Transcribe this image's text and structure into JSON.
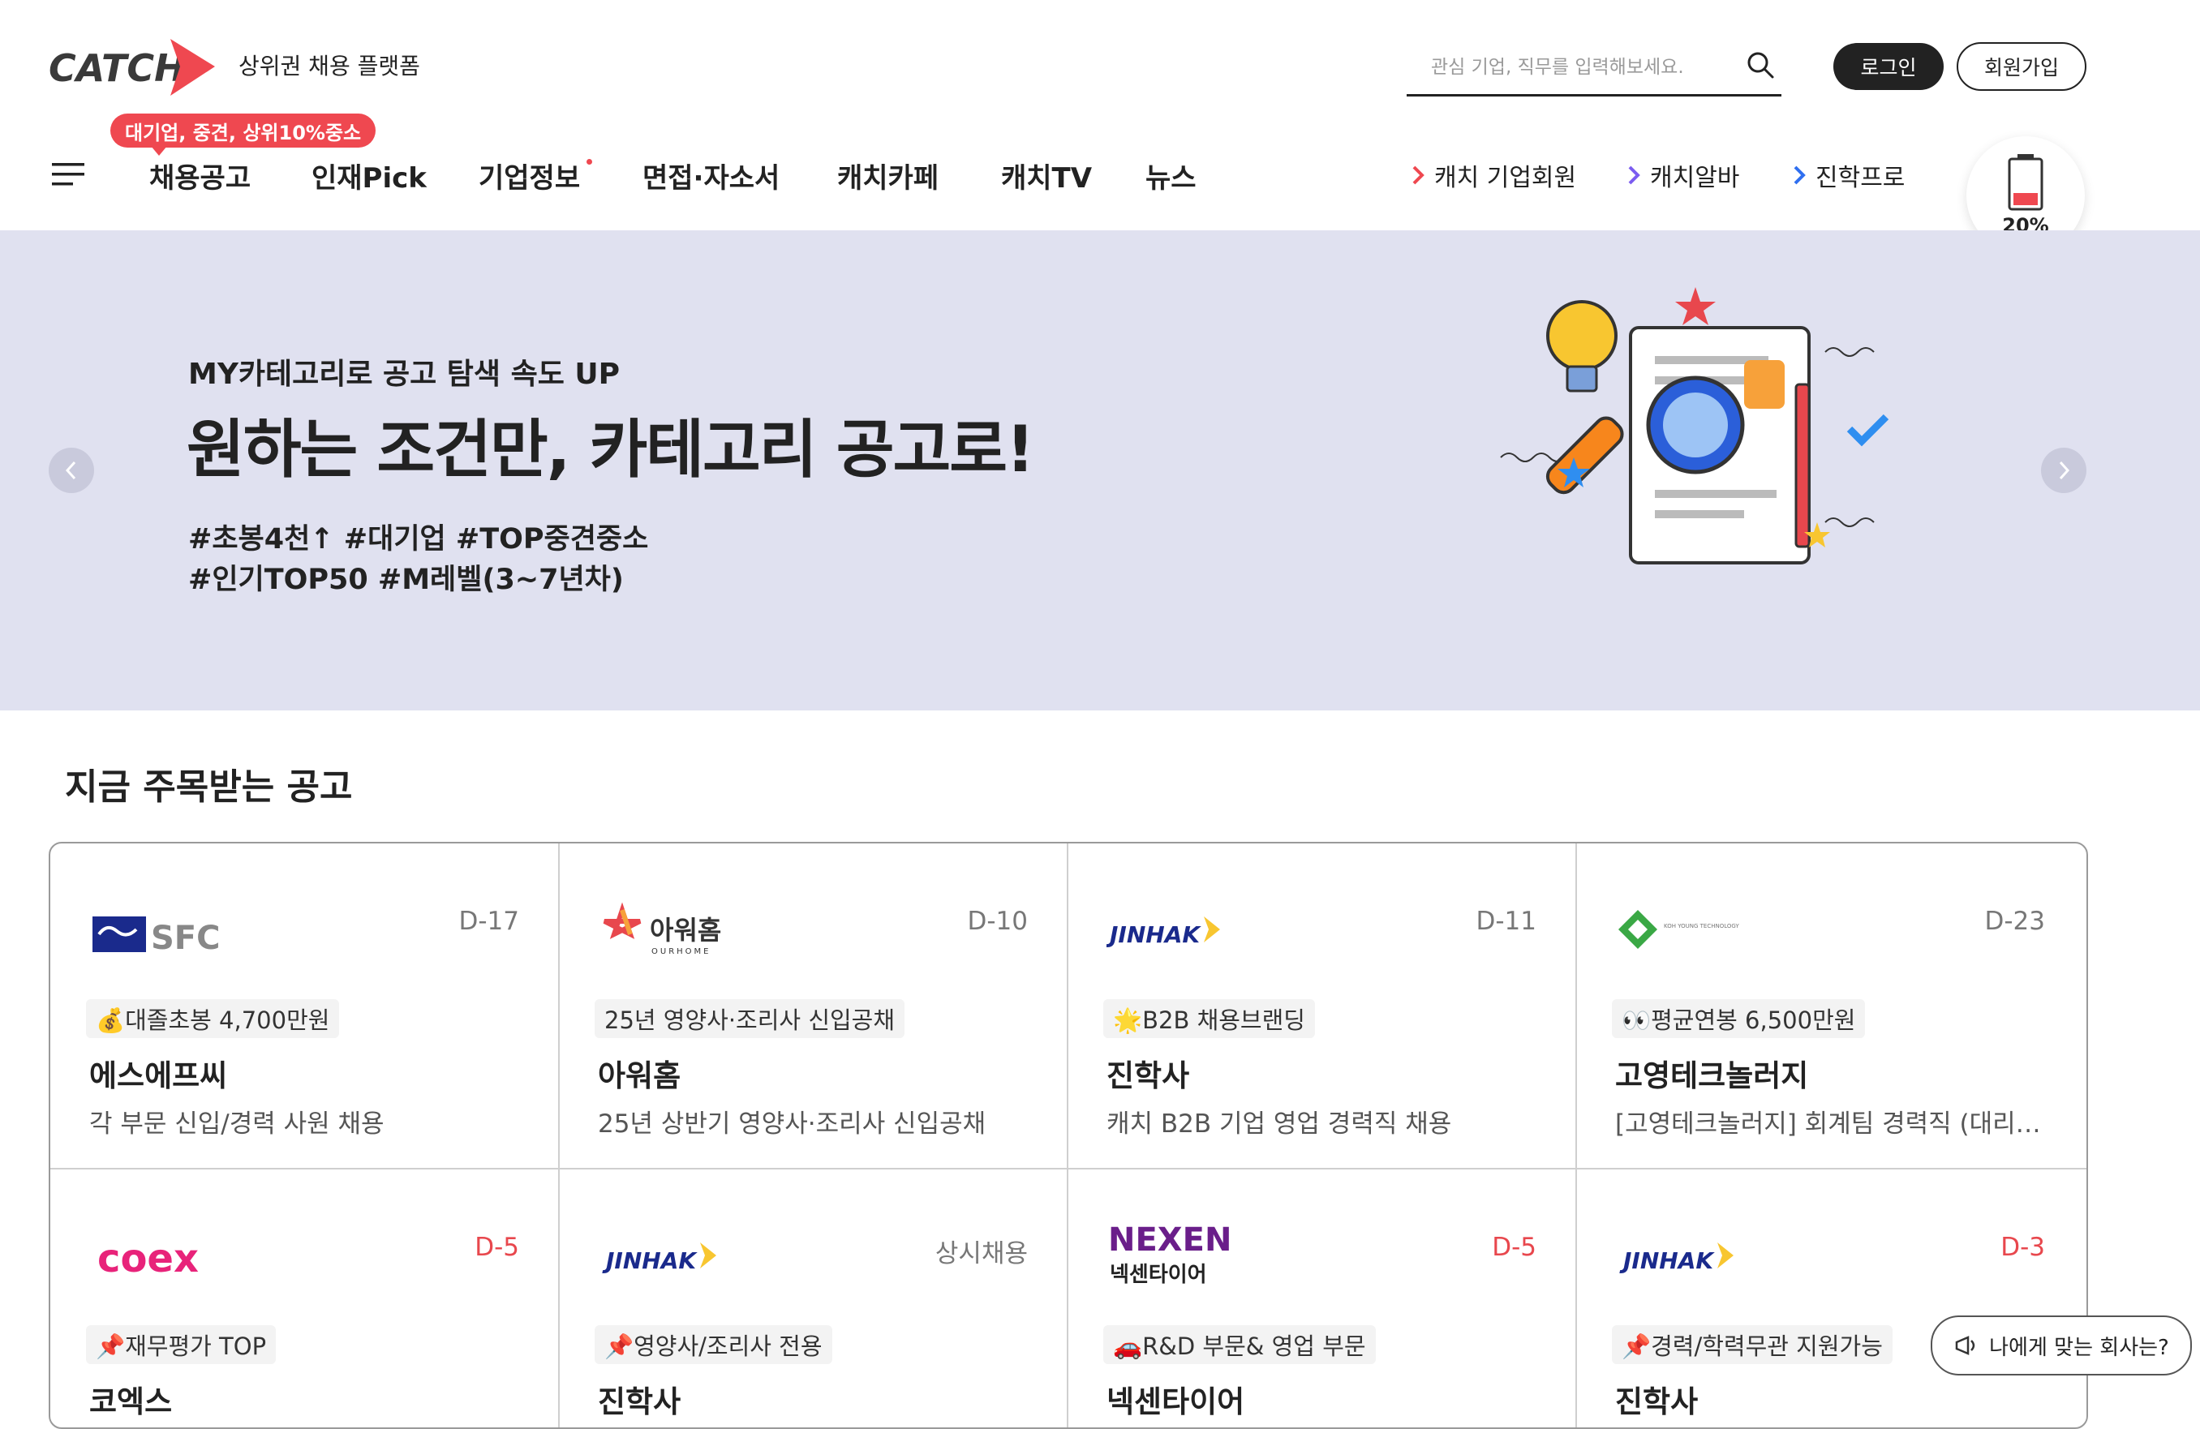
{
  "header": {
    "logo_text": "CATCH",
    "tagline": "상위권 채용 플랫폼",
    "search": {
      "placeholder": "관심 기업, 직무를 입력해보세요."
    },
    "login_label": "로그인",
    "signup_label": "회원가입"
  },
  "nav": {
    "promo_badge": "대기업, 중견, 상위10%중소",
    "items": [
      {
        "label": "채용공고"
      },
      {
        "label": "인재Pick"
      },
      {
        "label": "기업정보"
      },
      {
        "label": "면접·자소서"
      },
      {
        "label": "캐치카페"
      },
      {
        "label": "캐치TV"
      },
      {
        "label": "뉴스"
      }
    ],
    "external_links": [
      {
        "label": "캐치 기업회원",
        "color": "#ef4850"
      },
      {
        "label": "캐치알바",
        "color": "#7b5cf0"
      },
      {
        "label": "진학프로",
        "color": "#2f6ff0"
      }
    ],
    "battery_percent": "20%"
  },
  "hero": {
    "subtitle": "MY카테고리로 공고 탐색 속도 UP",
    "title": "원하는 조건만, 카테고리 공고로!",
    "tags_line1": "#초봉4천↑ #대기업 #TOP중견중소",
    "tags_line2": "#인기TOP50 #M레벨(3~7년차)",
    "background": "#e0e1f0"
  },
  "section": {
    "title": "지금 주목받는 공고"
  },
  "jobs": [
    {
      "logo": "SFC",
      "dday": "D-17",
      "tag": "💰대졸초봉 4,700만원",
      "company": "에스에프씨",
      "title": "각 부문 신입/경력 사원 채용"
    },
    {
      "logo": "아워홈",
      "logo_sub": "OURHOME",
      "dday": "D-10",
      "tag": "25년 영양사·조리사 신입공채",
      "company": "아워홈",
      "title": "25년 상반기 영양사·조리사 신입공채"
    },
    {
      "logo": "JINHAK",
      "dday": "D-11",
      "tag": "🌟B2B 채용브랜딩",
      "company": "진학사",
      "title": "캐치 B2B 기업 영업 경력직 채용"
    },
    {
      "logo": "KOH YOUNG TECHNOLOGY",
      "dday": "D-23",
      "tag": "👀평균연봉 6,500만원",
      "company": "고영테크놀러지",
      "title": "[고영테크놀러지] 회계팀 경력직 (대리~과장급) 채용"
    },
    {
      "logo": "coex",
      "dday": "D-5",
      "tag": "📌재무평가 TOP",
      "company": "코엑스",
      "title": ""
    },
    {
      "logo": "JINHAK",
      "dday": "상시채용",
      "tag": "📌영양사/조리사 전용",
      "company": "진학사",
      "title": ""
    },
    {
      "logo": "NEXEN",
      "logo_sub": "넥센타이어",
      "dday": "D-5",
      "tag": "🚗R&D 부문& 영업 부문",
      "company": "넥센타이어",
      "title": ""
    },
    {
      "logo": "JINHAK",
      "dday": "D-3",
      "tag": "📌경력/학력무관 지원가능",
      "company": "진학사",
      "title": ""
    }
  ],
  "float_button": {
    "label": "나에게 맞는 회사는?"
  },
  "colors": {
    "brand_red": "#ef4850",
    "dark": "#222222",
    "hero_bg": "#e0e1f0"
  }
}
